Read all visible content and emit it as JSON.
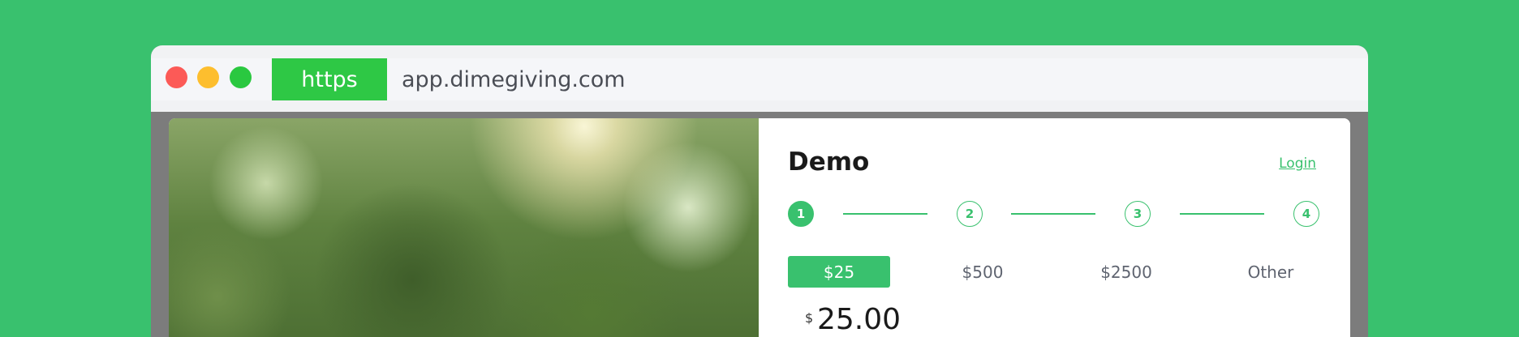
{
  "browser": {
    "protocol_badge": "https",
    "url": "app.dimegiving.com"
  },
  "form": {
    "title": "Demo",
    "login_link": "Login",
    "steps": [
      "1",
      "2",
      "3",
      "4"
    ],
    "active_step": "1",
    "amount_options": [
      "$25",
      "$500",
      "$2500",
      "Other"
    ],
    "selected_amount": "$25",
    "currency_symbol": "$",
    "amount_value": "25.00"
  },
  "colors": {
    "background": "#39c16e",
    "accent": "#39c16e",
    "https_badge": "#2ec845"
  }
}
